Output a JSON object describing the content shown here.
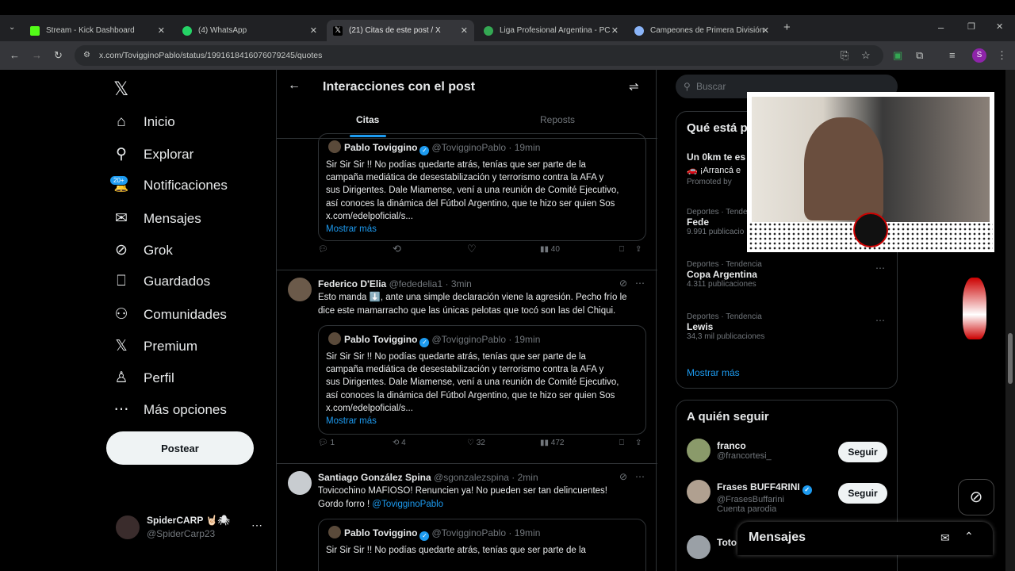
{
  "browser": {
    "tabs": [
      {
        "title": "Stream - Kick Dashboard",
        "color": "#53fc18"
      },
      {
        "title": "(4) WhatsApp",
        "color": "#25d366"
      },
      {
        "title": "(21) Citas de este post / X",
        "color": "#ffffff"
      },
      {
        "title": "Liga Profesional Argentina - PC",
        "color": "#34a853"
      },
      {
        "title": "Campeones de Primera División",
        "color": "#8ab4f8"
      }
    ],
    "url": "x.com/TovigginoPablo/status/1991618416076079245/quotes",
    "profile_letter": "S"
  },
  "nav": {
    "items": [
      {
        "label": "Inicio",
        "icon": "home-icon",
        "glyph": "⌂"
      },
      {
        "label": "Explorar",
        "icon": "search-icon",
        "glyph": "⚲"
      },
      {
        "label": "Notificaciones",
        "icon": "bell-icon",
        "glyph": "🔔"
      },
      {
        "label": "Mensajes",
        "icon": "mail-icon",
        "glyph": "✉"
      },
      {
        "label": "Grok",
        "icon": "grok-icon",
        "glyph": "⊘"
      },
      {
        "label": "Guardados",
        "icon": "bookmark-icon",
        "glyph": "⎕"
      },
      {
        "label": "Comunidades",
        "icon": "people-icon",
        "glyph": "⚇"
      },
      {
        "label": "Premium",
        "icon": "x-icon",
        "glyph": "𝕏"
      },
      {
        "label": "Perfil",
        "icon": "person-icon",
        "glyph": "♙"
      },
      {
        "label": "Más opciones",
        "icon": "more-icon",
        "glyph": "⋯"
      }
    ],
    "notif_badge": "20+",
    "post_button": "Postear",
    "account": {
      "name": "SpiderCARP 🤘🏻🕷",
      "handle": "@SpiderCarp23"
    }
  },
  "main": {
    "title": "Interacciones con el post",
    "tabs": [
      "Citas",
      "Reposts"
    ],
    "quoted": {
      "name": "Pablo Toviggino",
      "handle": "@TovigginoPablo",
      "time": "· 19min",
      "lines": [
        "Sir Sir Sir !! No podías quedarte atrás, tenías que ser parte de la",
        "campaña mediática de desestabilización y terrorismo contra la AFA y",
        "sus Dirigentes. Dale Miamense, vení a una reunión de Comité Ejecutivo,",
        "así conoces la dinámica del Fútbol Argentino, que te hizo ser quien Sos",
        "x.com/edelpoficial/s..."
      ],
      "more": "Mostrar más"
    },
    "tweet0": {
      "views": "40"
    },
    "tweet1": {
      "name": "Federico D'Elia",
      "handle": "@fededelia1",
      "time": "· 3min",
      "lines": [
        "Esto manda ⬇️, ante una simple declaración viene la agresión. Pecho frío le",
        "dice este mamarracho que las únicas pelotas que tocó son las del Chiqui."
      ],
      "replies": "1",
      "reposts": "4",
      "likes": "32",
      "views": "472"
    },
    "tweet2": {
      "name": "Santiago González Spina",
      "handle": "@sgonzalezspina",
      "time": "· 2min",
      "line1": "Tovicochino MAFIOSO! Renuncien ya! No pueden ser tan delincuentes!",
      "line2": "Gordo forro ! ",
      "mention": "@TovigginoPablo"
    }
  },
  "right": {
    "search_placeholder": "Buscar",
    "trends_title": "Qué está p",
    "promo": {
      "title": "Un 0km te es",
      "sub": "🚗 ¡Arrancá e",
      "promoted": "Promoted by"
    },
    "trends": [
      {
        "meta": "Deportes · Tende",
        "name": "Fede",
        "count": "9.991 publicacio"
      },
      {
        "meta": "Deportes · Tendencia",
        "name": "Copa Argentina",
        "count": "4.311 publicaciones"
      },
      {
        "meta": "Deportes · Tendencia",
        "name": "Lewis",
        "count": "34,3 mil publicaciones"
      }
    ],
    "show_more": "Mostrar más",
    "follow_title": "A quién seguir",
    "follow": [
      {
        "name": "franco",
        "handle": "@francortesi_",
        "button": "Seguir"
      },
      {
        "name": "Frases BUFF4RINI",
        "handle": "@FrasesBuffarini",
        "button": "Seguir",
        "sub": "Cuenta parodia"
      },
      {
        "name": "Toto",
        "handle": "@..."
      }
    ],
    "messages": "Mensajes"
  }
}
